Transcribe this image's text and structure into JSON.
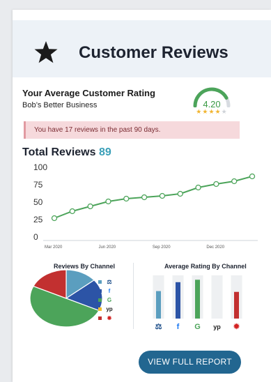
{
  "header": {
    "title": "Customer Reviews",
    "icon": "star-icon"
  },
  "rating": {
    "label": "Your Average Customer Rating",
    "business": "Bob’s Better Business",
    "value": "4.20",
    "stars_filled": 4,
    "stars_total": 5,
    "gauge_fraction": 0.84
  },
  "alert": {
    "text": "You have 17 reviews in the past 90 days."
  },
  "total": {
    "label": "Total Reviews",
    "count": "89"
  },
  "chart_data": [
    {
      "type": "line",
      "title": "Total Reviews",
      "ylim": [
        0,
        100
      ],
      "yticks": [
        "100",
        "75",
        "50",
        "25",
        "0"
      ],
      "xticks": [
        "Mar 2020",
        "Jun 2020",
        "Sep 2020",
        "Dec 2020"
      ],
      "x": [
        "Mar 2020",
        "Apr 2020",
        "May 2020",
        "Jun 2020",
        "Jul 2020",
        "Aug 2020",
        "Sep 2020",
        "Oct 2020",
        "Nov 2020",
        "Dec 2020",
        "Jan 2021",
        "Feb 2021"
      ],
      "series": [
        {
          "values": [
            27,
            37,
            44,
            51,
            55,
            57,
            59,
            62,
            71,
            76,
            80,
            87
          ]
        }
      ],
      "color": "#4ca45a",
      "grid": false
    },
    {
      "type": "pie",
      "title": "Reviews By Channel",
      "categories": [
        "Better Business Bureau",
        "Facebook",
        "Google",
        "Yellow Pages",
        "Yelp"
      ],
      "values": [
        14,
        18,
        50,
        0,
        18
      ],
      "colors": [
        "#5b9ebf",
        "#2c54a6",
        "#4ca45a",
        "#f3bd2c",
        "#c23030"
      ]
    },
    {
      "type": "bar",
      "title": "Average Rating By Channel",
      "categories": [
        "Better Business Bureau",
        "Facebook",
        "Google",
        "Yellow Pages",
        "Yelp"
      ],
      "values": [
        3.4,
        4.5,
        4.8,
        0,
        3.3
      ],
      "ylim": [
        0,
        5
      ],
      "colors": [
        "#5b9ebf",
        "#2c54a6",
        "#4ca45a",
        "#f3bd2c",
        "#c23030"
      ]
    }
  ],
  "channels": [
    {
      "icon": "bbb-icon",
      "glyph": "⚖",
      "color": "#1d4e89"
    },
    {
      "icon": "facebook-icon",
      "glyph": "f",
      "color": "#1877f2"
    },
    {
      "icon": "google-icon",
      "glyph": "G",
      "color": "#4ca45a"
    },
    {
      "icon": "yellowpages-icon",
      "glyph": "yp",
      "color": "#1d1d1d"
    },
    {
      "icon": "yelp-icon",
      "glyph": "✹",
      "color": "#d32323"
    }
  ],
  "button": {
    "label": "VIEW FULL REPORT"
  }
}
